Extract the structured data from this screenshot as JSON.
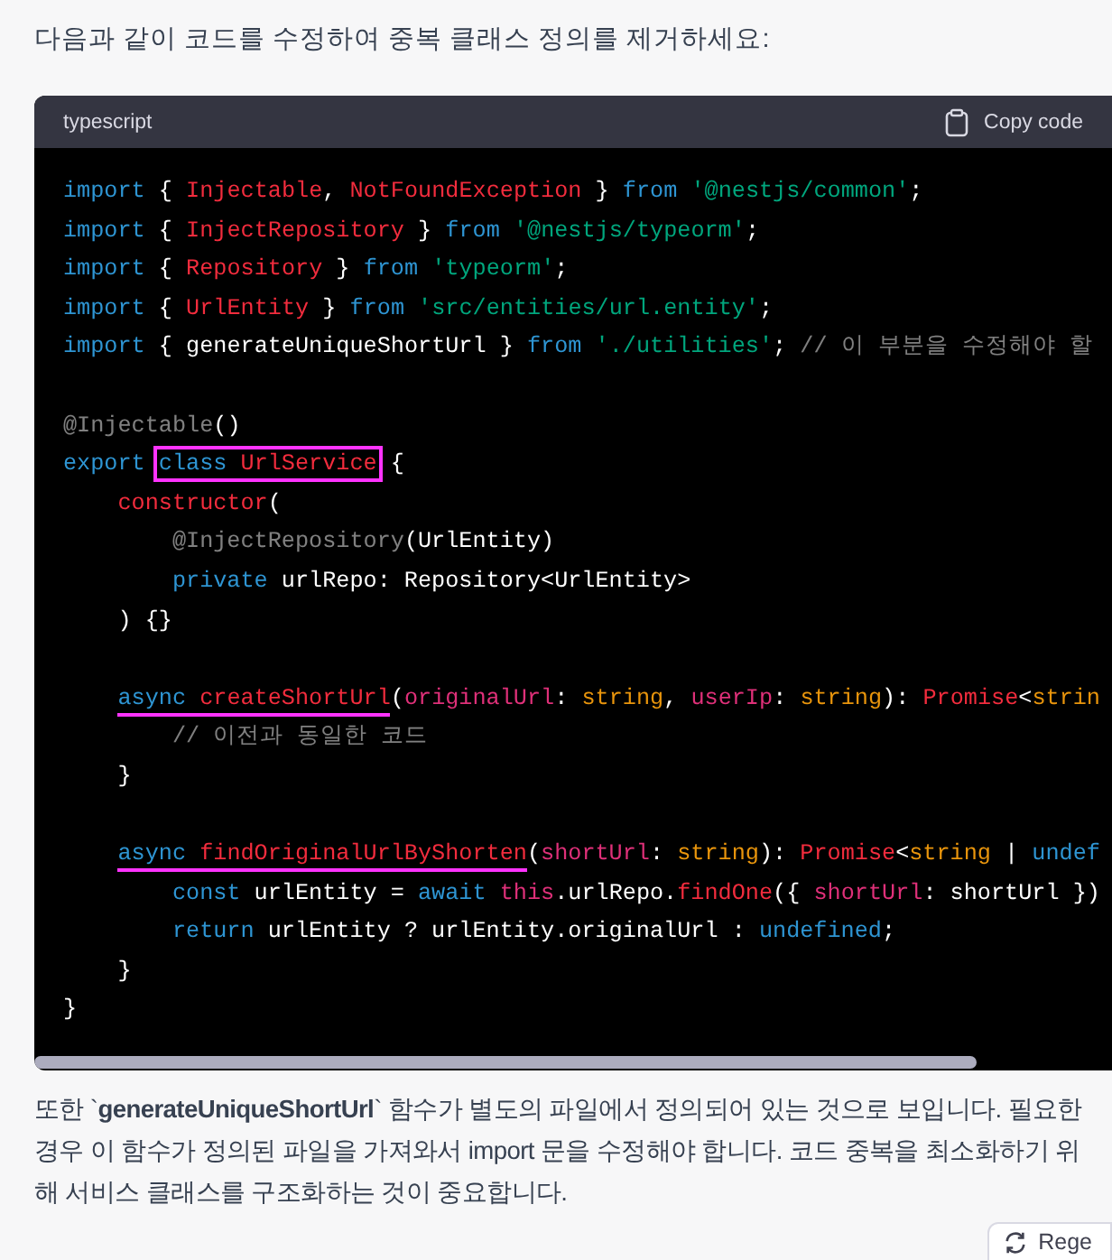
{
  "intro": "다음과 같이 코드를 수정하여 중복 클래스 정의를 제거하세요:",
  "code_block": {
    "language": "typescript",
    "copy_label": "Copy code",
    "lines": [
      {
        "tokens": [
          {
            "kind": "kw",
            "text": "import"
          },
          {
            "kind": "plain",
            "text": " { "
          },
          {
            "kind": "name",
            "text": "Injectable"
          },
          {
            "kind": "plain",
            "text": ", "
          },
          {
            "kind": "name",
            "text": "NotFoundException"
          },
          {
            "kind": "plain",
            "text": " } "
          },
          {
            "kind": "kw",
            "text": "from"
          },
          {
            "kind": "str",
            "text": " '@nestjs/common'"
          },
          {
            "kind": "plain",
            "text": ";"
          }
        ]
      },
      {
        "tokens": [
          {
            "kind": "kw",
            "text": "import"
          },
          {
            "kind": "plain",
            "text": " { "
          },
          {
            "kind": "name",
            "text": "InjectRepository"
          },
          {
            "kind": "plain",
            "text": " } "
          },
          {
            "kind": "kw",
            "text": "from"
          },
          {
            "kind": "str",
            "text": " '@nestjs/typeorm'"
          },
          {
            "kind": "plain",
            "text": ";"
          }
        ]
      },
      {
        "tokens": [
          {
            "kind": "kw",
            "text": "import"
          },
          {
            "kind": "plain",
            "text": " { "
          },
          {
            "kind": "name",
            "text": "Repository"
          },
          {
            "kind": "plain",
            "text": " } "
          },
          {
            "kind": "kw",
            "text": "from"
          },
          {
            "kind": "str",
            "text": " 'typeorm'"
          },
          {
            "kind": "plain",
            "text": ";"
          }
        ]
      },
      {
        "tokens": [
          {
            "kind": "kw",
            "text": "import"
          },
          {
            "kind": "plain",
            "text": " { "
          },
          {
            "kind": "name",
            "text": "UrlEntity"
          },
          {
            "kind": "plain",
            "text": " } "
          },
          {
            "kind": "kw",
            "text": "from"
          },
          {
            "kind": "str",
            "text": " 'src/entities/url.entity'"
          },
          {
            "kind": "plain",
            "text": ";"
          }
        ]
      },
      {
        "tokens": [
          {
            "kind": "kw",
            "text": "import"
          },
          {
            "kind": "plain",
            "text": " { generateUniqueShortUrl } "
          },
          {
            "kind": "kw",
            "text": "from"
          },
          {
            "kind": "str",
            "text": " './utilities'"
          },
          {
            "kind": "plain",
            "text": ";"
          },
          {
            "kind": "comment",
            "text": " // 이 부분을 수정해야 할"
          }
        ]
      },
      {
        "gap_before": true,
        "tokens": [
          {
            "kind": "comment",
            "text": "@Injectable"
          },
          {
            "kind": "plain",
            "text": "()"
          }
        ]
      },
      {
        "tokens": [
          {
            "kind": "kw",
            "text": "export"
          },
          {
            "kind": "boxed",
            "tokens": [
              {
                "kind": "kw",
                "text": "class"
              },
              {
                "kind": "name",
                "text": " UrlService"
              }
            ]
          },
          {
            "kind": "plain",
            "text": " {"
          }
        ],
        "children": [
          {
            "tokens": [
              {
                "kind": "name",
                "text": "constructor"
              },
              {
                "kind": "plain",
                "text": "("
              }
            ],
            "children": [
              {
                "tokens": [
                  {
                    "kind": "comment",
                    "text": "@InjectRepository"
                  },
                  {
                    "kind": "plain",
                    "text": "(UrlEntity)"
                  }
                ]
              },
              {
                "tokens": [
                  {
                    "kind": "kw",
                    "text": "private"
                  },
                  {
                    "kind": "plain",
                    "text": " urlRepo: Repository<UrlEntity>"
                  }
                ]
              }
            ]
          },
          {
            "tokens": [
              {
                "kind": "plain",
                "text": ") {}"
              }
            ]
          },
          {
            "gap_before": true,
            "tokens": [
              {
                "kind": "underlined",
                "tokens": [
                  {
                    "kind": "kw",
                    "text": "async"
                  },
                  {
                    "kind": "name",
                    "text": " createShortUrl"
                  }
                ]
              },
              {
                "kind": "plain",
                "text": "("
              },
              {
                "kind": "param",
                "text": "originalUrl"
              },
              {
                "kind": "plain",
                "text": ": "
              },
              {
                "kind": "type",
                "text": "string"
              },
              {
                "kind": "plain",
                "text": ", "
              },
              {
                "kind": "param",
                "text": "userIp"
              },
              {
                "kind": "plain",
                "text": ": "
              },
              {
                "kind": "type",
                "text": "string"
              },
              {
                "kind": "plain",
                "text": "): "
              },
              {
                "kind": "name",
                "text": "Promise"
              },
              {
                "kind": "plain",
                "text": "<"
              },
              {
                "kind": "type",
                "text": "strin"
              }
            ],
            "children": [
              {
                "tokens": [
                  {
                    "kind": "comment",
                    "text": "// 이전과 동일한 코드"
                  }
                ]
              }
            ]
          },
          {
            "tokens": [
              {
                "kind": "plain",
                "text": "}"
              }
            ]
          },
          {
            "gap_before": true,
            "tokens": [
              {
                "kind": "underlined",
                "tokens": [
                  {
                    "kind": "kw",
                    "text": "async"
                  },
                  {
                    "kind": "name",
                    "text": " findOriginalUrlByShorten"
                  }
                ]
              },
              {
                "kind": "plain",
                "text": "("
              },
              {
                "kind": "param",
                "text": "shortUrl"
              },
              {
                "kind": "plain",
                "text": ": "
              },
              {
                "kind": "type",
                "text": "string"
              },
              {
                "kind": "plain",
                "text": "): "
              },
              {
                "kind": "name",
                "text": "Promise"
              },
              {
                "kind": "plain",
                "text": "<"
              },
              {
                "kind": "type",
                "text": "string"
              },
              {
                "kind": "plain",
                "text": " | "
              },
              {
                "kind": "kw",
                "text": "undef"
              }
            ],
            "children": [
              {
                "tokens": [
                  {
                    "kind": "kw",
                    "text": "const"
                  },
                  {
                    "kind": "plain",
                    "text": " urlEntity = "
                  },
                  {
                    "kind": "kw",
                    "text": "await"
                  },
                  {
                    "kind": "param",
                    "text": " this"
                  },
                  {
                    "kind": "plain",
                    "text": ".urlRepo."
                  },
                  {
                    "kind": "name",
                    "text": "findOne"
                  },
                  {
                    "kind": "plain",
                    "text": "({ "
                  },
                  {
                    "kind": "param",
                    "text": "shortUrl"
                  },
                  {
                    "kind": "plain",
                    "text": ": shortUrl })"
                  }
                ]
              },
              {
                "tokens": [
                  {
                    "kind": "kw",
                    "text": "return"
                  },
                  {
                    "kind": "plain",
                    "text": " urlEntity ? urlEntity.originalUrl : "
                  },
                  {
                    "kind": "kw",
                    "text": "undefined"
                  },
                  {
                    "kind": "plain",
                    "text": ";"
                  }
                ]
              }
            ]
          },
          {
            "tokens": [
              {
                "kind": "plain",
                "text": "}"
              }
            ]
          }
        ]
      },
      {
        "tokens": [
          {
            "kind": "plain",
            "text": "}"
          }
        ]
      }
    ]
  },
  "paragraph": "또한 `**generateUniqueShortUrl**` 함수가 별도의 파일에서 정의되어 있는 것으로 보입니다. 필요한 경우 이 함수가 정의된 파일을 가져와서 import 문을 수정해야 합니다. 코드 중복을 최소화하기 위해 서비스 클래스를 구조화하는 것이 중요합니다.",
  "regenerate_button": "Rege"
}
